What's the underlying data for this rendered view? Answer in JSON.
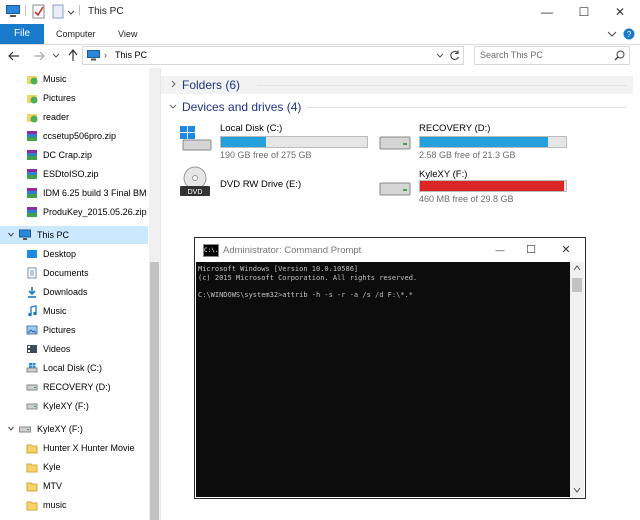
{
  "window": {
    "title": "This PC"
  },
  "ribbon": {
    "tabs": [
      "File",
      "Computer",
      "View"
    ]
  },
  "address": {
    "location": "This PC",
    "search_placeholder": "Search This PC"
  },
  "nav": {
    "quick": [
      "Music",
      "Pictures",
      "reader",
      "ccsetup506pro.zip",
      "DC Crap.zip",
      "ESDtoISO.zip",
      "IDM 6.25 build 3 Final BM",
      "ProduKey_2015.05.26.zip"
    ],
    "this_pc": "This PC",
    "pc_items": [
      "Desktop",
      "Documents",
      "Downloads",
      "Music",
      "Pictures",
      "Videos",
      "Local Disk (C:)",
      "RECOVERY (D:)",
      "KyleXY (F:)"
    ],
    "drive": "KyleXY (F:)",
    "drive_items": [
      "Hunter X Hunter Movie",
      "Kyle",
      "MTV",
      "music"
    ]
  },
  "content": {
    "folders_header": "Folders (6)",
    "devices_header": "Devices and drives (4)",
    "drives": [
      {
        "name": "Local Disk (C:)",
        "free": "190 GB free of 275 GB",
        "used_fraction": 0.31,
        "color": "#26a0da"
      },
      {
        "name": "RECOVERY (D:)",
        "free": "2.58 GB free of 21.3 GB",
        "used_fraction": 0.88,
        "color": "#26a0da"
      },
      {
        "name": "DVD RW Drive (E:)"
      },
      {
        "name": "KyleXY (F:)",
        "free": "460 MB free of 29.8 GB",
        "used_fraction": 0.985,
        "color": "#da2626"
      }
    ]
  },
  "cmd": {
    "title": "Administrator: Command Prompt",
    "icon_text": "C:\\.",
    "lines": [
      "Microsoft Windows [Version 10.0.10586]",
      "(c) 2015 Microsoft Corporation. All rights reserved.",
      "",
      "C:\\WINDOWS\\system32>attrib -h -s -r -a /s /d F:\\*.*"
    ]
  },
  "colors": {
    "accent": "#1979ca",
    "selection": "#cce8ff",
    "header": "#1e3287"
  }
}
